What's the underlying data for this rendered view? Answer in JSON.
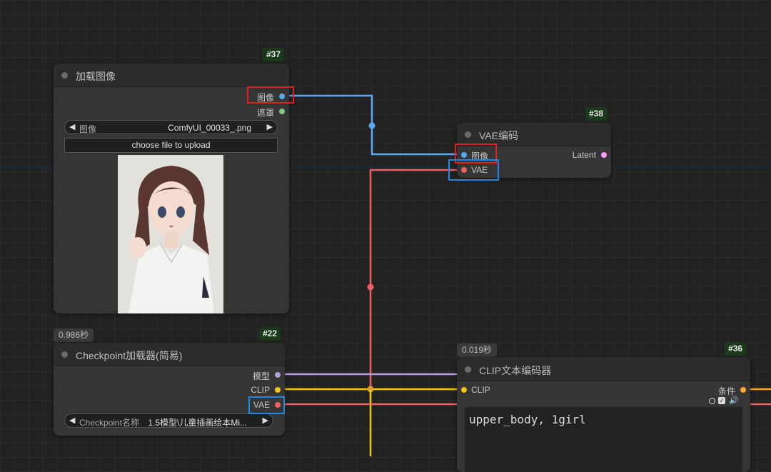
{
  "colors": {
    "image": "#5aa9ef",
    "mask": "#7fc97f",
    "vae": "#ef6060",
    "clip": "#f0c419",
    "model": "#b39ddb",
    "latent": "#ff9cf9",
    "conditioning": "#ffa931",
    "highlight_red": "#e02020",
    "highlight_blue": "#1e88e5"
  },
  "nodes": {
    "load_image": {
      "id": "#37",
      "title": "加载图像",
      "outputs": [
        "图像",
        "遮罩"
      ],
      "widget_label": "图像",
      "widget_value": "ComfyUI_00033_.png",
      "upload_label": "choose file to upload",
      "preview_alt": "anime girl portrait preview"
    },
    "vae_encode": {
      "id": "#38",
      "title": "VAE编码",
      "inputs": [
        "图像",
        "VAE"
      ],
      "output": "Latent"
    },
    "checkpoint": {
      "id": "#22",
      "timing": "0.986秒",
      "title": "Checkpoint加载器(简易)",
      "outputs": [
        "模型",
        "CLIP",
        "VAE"
      ],
      "widget_label": "Checkpoint名称",
      "widget_value": "1.5模型\\儿童插画绘本Mi..."
    },
    "clip_encode": {
      "id": "#36",
      "timing": "0.019秒",
      "title": "CLIP文本编码器",
      "input": "CLIP",
      "output": "条件",
      "text": "upper_body, 1girl"
    }
  }
}
